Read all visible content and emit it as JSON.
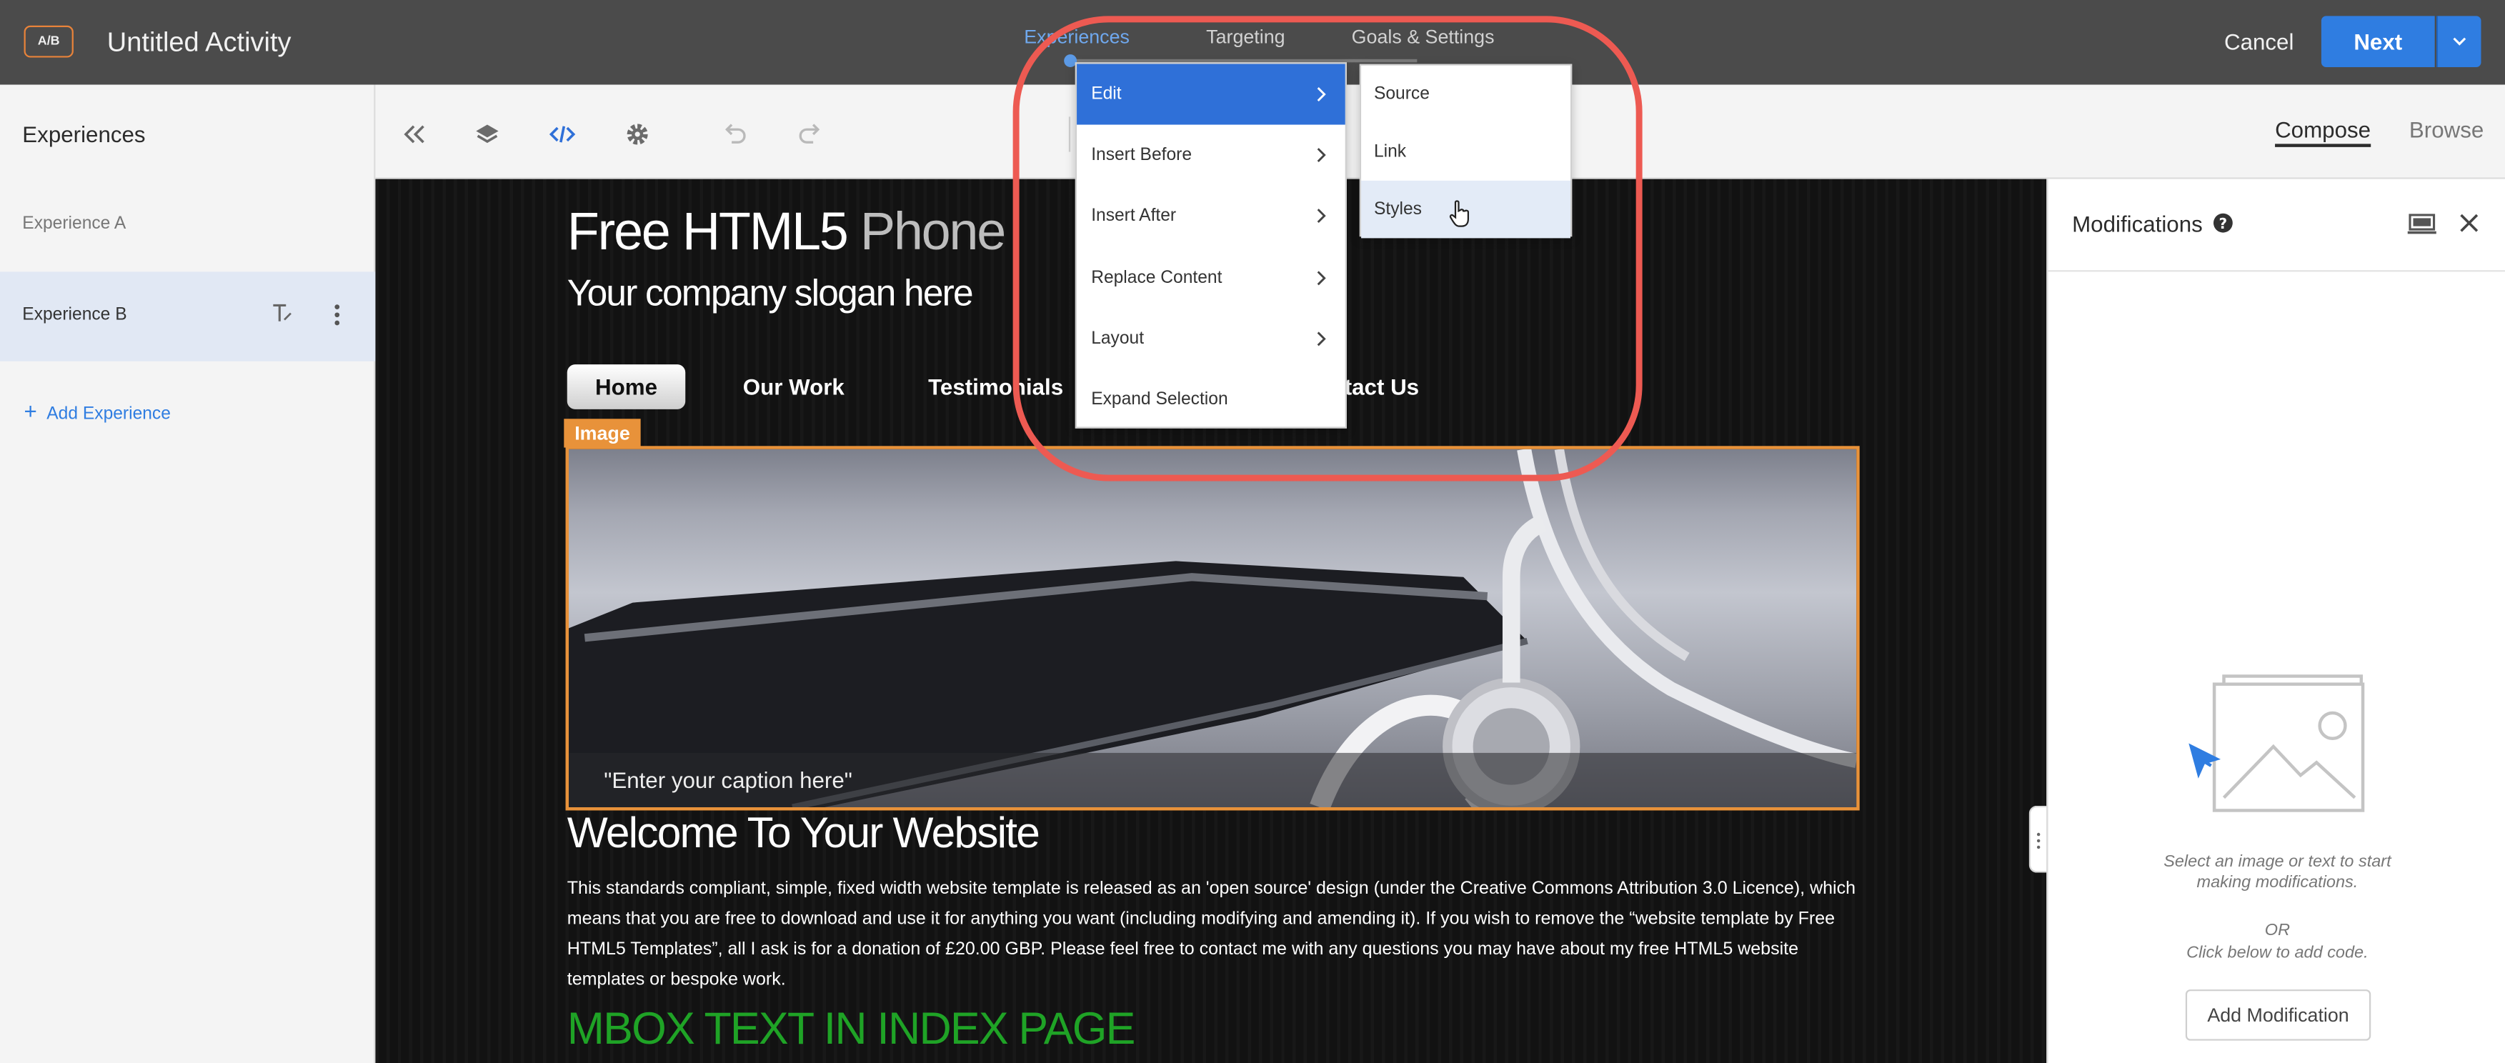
{
  "header": {
    "badge": "A/B",
    "title": "Untitled Activity",
    "steps": [
      "Experiences",
      "Targeting",
      "Goals & Settings"
    ],
    "cancel_label": "Cancel",
    "next_label": "Next"
  },
  "sidebar": {
    "heading": "Experiences",
    "items": [
      {
        "label": "Experience A",
        "selected": false
      },
      {
        "label": "Experience B",
        "selected": true
      }
    ],
    "add_label": "Add Experience"
  },
  "toolbar": {
    "icons": [
      "collapse-double-chevron-icon",
      "layers-icon",
      "code-icon",
      "gear-icon",
      "undo-icon",
      "redo-icon"
    ],
    "modes": [
      "Compose",
      "Browse"
    ],
    "active_mode": "Compose"
  },
  "site": {
    "title_main": "Free HTML5",
    "title_accent": "Phone",
    "slogan": "Your company slogan here",
    "nav": [
      "Home",
      "Our Work",
      "Testimonials",
      "ntact Us"
    ],
    "image_tag": "Image",
    "caption": "\"Enter your caption here\"",
    "welcome": "Welcome To Your Website",
    "body": "This standards compliant, simple, fixed width website template is released as an 'open source' design (under the Creative Commons Attribution 3.0 Licence), which means that you are free to download and use it for anything you want (including modifying and amending it). If you wish to remove the “website template by Free HTML5 Templates”, all I ask is for a donation of £20.00 GBP. Please feel free to contact me with any questions you may have about my free HTML5 website templates or bespoke work.",
    "mbox": "MBOX TEXT IN INDEX PAGE"
  },
  "context_menu": {
    "items": [
      "Edit",
      "Insert Before",
      "Insert After",
      "Replace Content",
      "Layout",
      "Expand Selection"
    ],
    "active": "Edit",
    "submenu": [
      "Source",
      "Link",
      "Styles"
    ],
    "hover": "Styles"
  },
  "modifications": {
    "title": "Modifications",
    "hint": "Select an image or text to start making modifications.",
    "hint_lines": [
      "Select an image or text to start",
      "making modifications."
    ],
    "or": "OR",
    "code_hint": "Click below to add code.",
    "add_label": "Add Modification"
  },
  "colors": {
    "accent": "#2f7de1",
    "highlight_border": "#e8923a",
    "annotation": "#ed5a52",
    "mbox_text": "#1fa326"
  }
}
